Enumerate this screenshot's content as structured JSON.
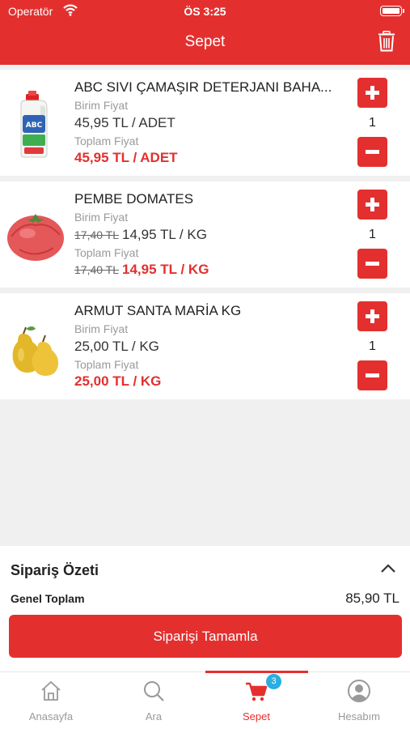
{
  "status_bar": {
    "carrier": "Operatör",
    "time": "ÖS 3:25"
  },
  "header": {
    "title": "Sepet"
  },
  "items": [
    {
      "name": "ABC SIVI ÇAMAŞIR DETERJANI BAHA...",
      "unit_label": "Birim Fiyat",
      "unit_price": "45,95 TL / ADET",
      "unit_old_price": "",
      "total_label": "Toplam Fiyat",
      "total_price": "45,95 TL / ADET",
      "total_old_price": "",
      "quantity": "1"
    },
    {
      "name": "PEMBE DOMATES",
      "unit_label": "Birim Fiyat",
      "unit_price": "14,95 TL / KG",
      "unit_old_price": "17,40 TL",
      "total_label": "Toplam Fiyat",
      "total_price": "14,95 TL / KG",
      "total_old_price": "17,40 TL",
      "quantity": "1"
    },
    {
      "name": "ARMUT SANTA MARİA KG",
      "unit_label": "Birim Fiyat",
      "unit_price": "25,00 TL / KG",
      "unit_old_price": "",
      "total_label": "Toplam Fiyat",
      "total_price": "25,00 TL / KG",
      "total_old_price": "",
      "quantity": "1"
    }
  ],
  "summary": {
    "title": "Sipariş Özeti",
    "grand_total_label": "Genel Toplam",
    "grand_total_value": "85,90 TL",
    "complete_button": "Siparişi Tamamla"
  },
  "tabbar": {
    "tabs": [
      {
        "label": "Anasayfa",
        "icon": "home-icon"
      },
      {
        "label": "Ara",
        "icon": "search-icon"
      },
      {
        "label": "Sepet",
        "icon": "cart-icon",
        "badge": "3",
        "active": true
      },
      {
        "label": "Hesabım",
        "icon": "account-icon"
      }
    ]
  },
  "colors": {
    "brand_red": "#e3302f",
    "badge_blue": "#2aaee0",
    "background": "#f0f0f0"
  }
}
